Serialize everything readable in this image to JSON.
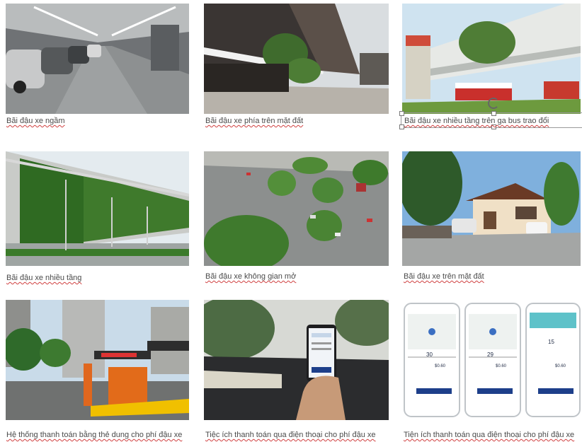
{
  "captions": {
    "c1": "Bãi đậu xe ngầm",
    "c2": "Bãi đậu xe phía trên mặt đất",
    "c3": "Bãi đậu xe nhiều tầng trên ga bus trao đổi",
    "c4": "Bãi đậu xe nhiều tầng",
    "c5": "Bãi đậu xe không gian mở",
    "c6": "Bãi đậu xe trên mặt đất",
    "c7": "Hệ thống thanh toán bằng thẻ  dung cho phí đậu xe",
    "c8": "Tiệc ích thanh toán qua điện thoại cho phí đậu xe",
    "c9": "Tiện ích thanh toán qua điện thoại cho phí đậu xe"
  },
  "photos": [
    {
      "icon": "underground-parking-photo"
    },
    {
      "icon": "surface-parking-building-photo"
    },
    {
      "icon": "multistorey-bus-interchange-photo"
    },
    {
      "icon": "green-wall-multistorey-photo"
    },
    {
      "icon": "open-space-parking-aerial-photo"
    },
    {
      "icon": "house-driveway-parking-photo"
    },
    {
      "icon": "card-payment-gantry-photo"
    },
    {
      "icon": "phone-payment-in-car-photo"
    },
    {
      "icon": "parking-app-screens-photo"
    }
  ],
  "app_screens": {
    "values": [
      "30",
      "29",
      "15"
    ],
    "price": "$0.60"
  }
}
